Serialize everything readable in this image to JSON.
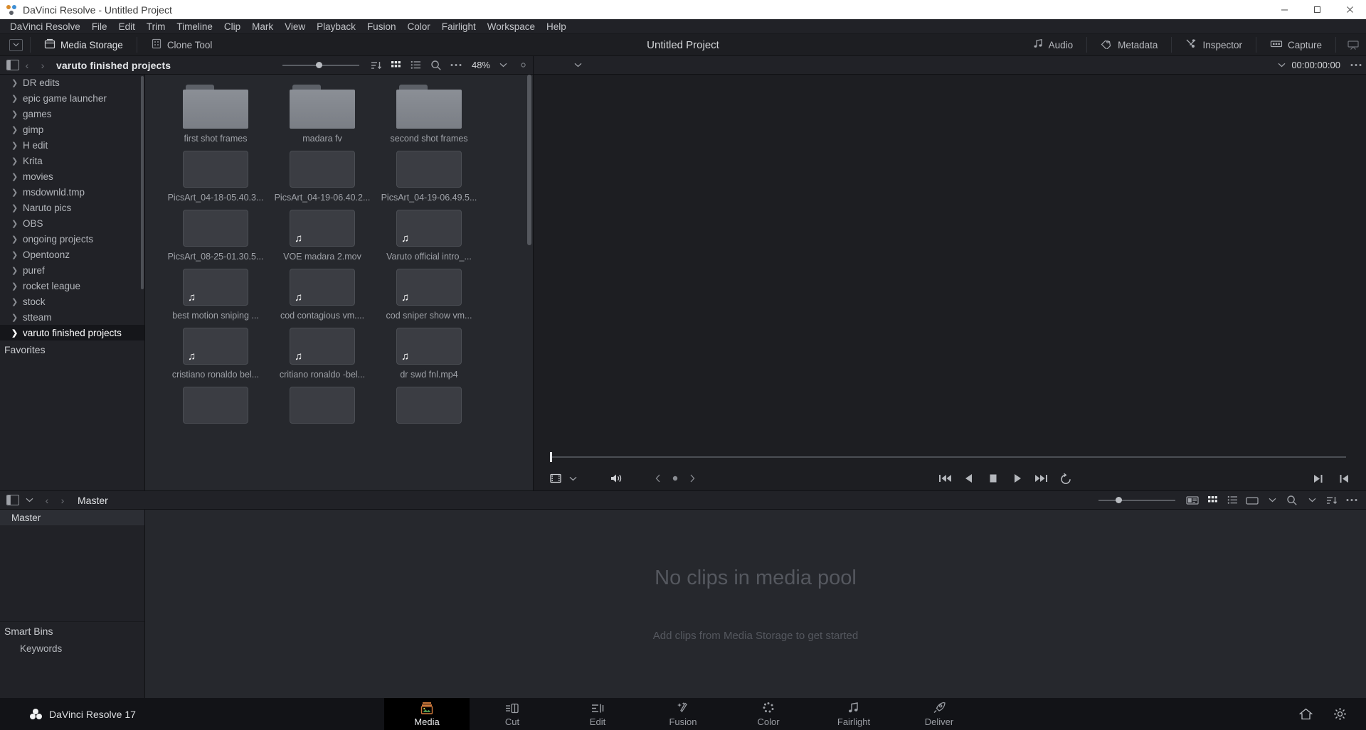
{
  "window": {
    "title": "DaVinci Resolve - Untitled Project",
    "minimize_label": "Minimize",
    "maximize_label": "Maximize",
    "close_label": "Close"
  },
  "menubar": {
    "items": [
      "DaVinci Resolve",
      "File",
      "Edit",
      "Trim",
      "Timeline",
      "Clip",
      "Mark",
      "View",
      "Playback",
      "Fusion",
      "Color",
      "Fairlight",
      "Workspace",
      "Help"
    ]
  },
  "toolbar": {
    "media_storage_label": "Media Storage",
    "clone_tool_label": "Clone Tool",
    "project_title": "Untitled Project",
    "right_buttons": [
      "Audio",
      "Metadata",
      "Inspector",
      "Capture"
    ]
  },
  "media_storage": {
    "path": "varuto finished projects",
    "zoom_level": "48%",
    "tree": {
      "items": [
        {
          "label": "DR edits",
          "selected": false
        },
        {
          "label": "epic game launcher",
          "selected": false
        },
        {
          "label": "games",
          "selected": false
        },
        {
          "label": "gimp",
          "selected": false
        },
        {
          "label": "H edit",
          "selected": false
        },
        {
          "label": "Krita",
          "selected": false
        },
        {
          "label": "movies",
          "selected": false
        },
        {
          "label": "msdownld.tmp",
          "selected": false
        },
        {
          "label": "Naruto pics",
          "selected": false
        },
        {
          "label": "OBS",
          "selected": false
        },
        {
          "label": "ongoing projects",
          "selected": false
        },
        {
          "label": "Opentoonz",
          "selected": false
        },
        {
          "label": "puref",
          "selected": false
        },
        {
          "label": "rocket league",
          "selected": false
        },
        {
          "label": "stock",
          "selected": false
        },
        {
          "label": "stteam",
          "selected": false
        },
        {
          "label": "varuto finished projects",
          "selected": true
        }
      ],
      "favorites_label": "Favorites"
    },
    "files": [
      {
        "name": "first shot frames",
        "type": "folder",
        "audio": false
      },
      {
        "name": "madara fv",
        "type": "folder",
        "audio": false
      },
      {
        "name": "second shot frames",
        "type": "folder",
        "audio": false
      },
      {
        "name": "PicsArt_04-18-05.40.3...",
        "type": "clip",
        "audio": false
      },
      {
        "name": "PicsArt_04-19-06.40.2...",
        "type": "clip",
        "audio": false
      },
      {
        "name": "PicsArt_04-19-06.49.5...",
        "type": "clip",
        "audio": false
      },
      {
        "name": "PicsArt_08-25-01.30.5...",
        "type": "clip",
        "audio": false
      },
      {
        "name": "VOE madara 2.mov",
        "type": "clip",
        "audio": true
      },
      {
        "name": "Varuto official intro_...",
        "type": "clip",
        "audio": true
      },
      {
        "name": "best motion sniping ...",
        "type": "clip",
        "audio": true
      },
      {
        "name": "cod contagious vm....",
        "type": "clip",
        "audio": true
      },
      {
        "name": "cod sniper show vm...",
        "type": "clip",
        "audio": true
      },
      {
        "name": "cristiano ronaldo bel...",
        "type": "clip",
        "audio": true
      },
      {
        "name": "critiano ronaldo -bel...",
        "type": "clip",
        "audio": true
      },
      {
        "name": "dr swd fnl.mp4",
        "type": "clip",
        "audio": true
      },
      {
        "name": "",
        "type": "clip",
        "audio": false
      },
      {
        "name": "",
        "type": "clip",
        "audio": false
      },
      {
        "name": "",
        "type": "clip",
        "audio": false
      }
    ]
  },
  "viewer": {
    "timecode": "00:00:00:00"
  },
  "media_pool": {
    "title": "Master",
    "bin_label": "Master",
    "smart_bins_label": "Smart Bins",
    "keywords_label": "Keywords",
    "empty_title": "No clips in media pool",
    "empty_subtitle": "Add clips from Media Storage to get started"
  },
  "bottom_bar": {
    "brand": "DaVinci Resolve 17",
    "pages": [
      {
        "label": "Media",
        "active": true
      },
      {
        "label": "Cut",
        "active": false
      },
      {
        "label": "Edit",
        "active": false
      },
      {
        "label": "Fusion",
        "active": false
      },
      {
        "label": "Color",
        "active": false
      },
      {
        "label": "Fairlight",
        "active": false
      },
      {
        "label": "Deliver",
        "active": false
      }
    ]
  },
  "colors": {
    "window_bg": "#1d1e22",
    "panel_bg": "#212227",
    "content_bg": "#26282d",
    "accent_selected": "#15161a",
    "text_primary": "#e3e5e8",
    "text_secondary": "#9fa2a8"
  }
}
